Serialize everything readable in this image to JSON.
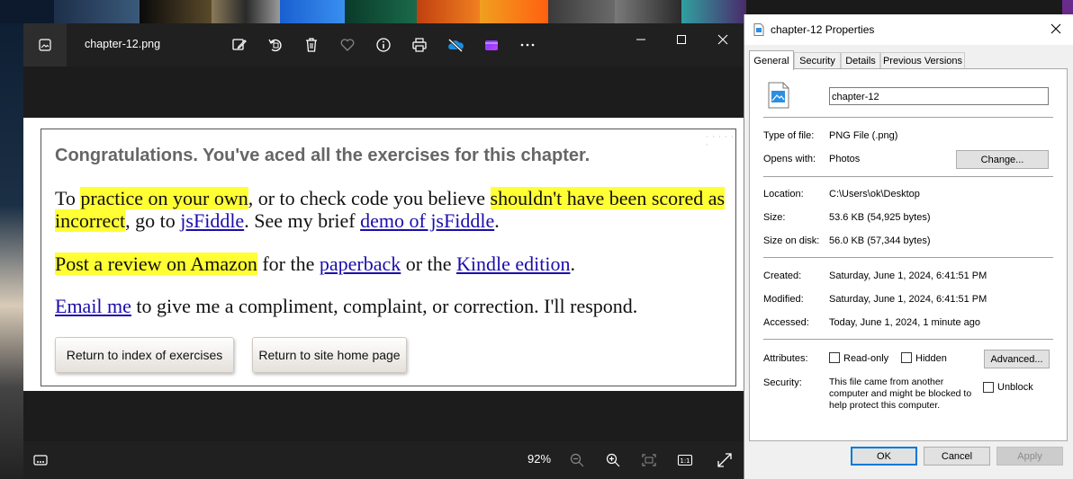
{
  "photos": {
    "filename": "chapter-12.png",
    "zoom": "92%",
    "toolbar_icons": [
      "edit-icon",
      "rotate-icon",
      "delete-icon",
      "favorite-icon",
      "info-icon",
      "print-icon",
      "onedrive-icon",
      "clipchamp-icon",
      "more-icon"
    ],
    "image": {
      "heading": "Congratulations. You've aced all the exercises for this chapter.",
      "p1": {
        "t1": "To ",
        "h1": "practice on your own",
        "t2": ", or to check code you believe ",
        "h2": "shouldn't have been scored as incorrect",
        "t3": ", go to ",
        "l1": "jsFiddle",
        "t4": ". See my brief ",
        "l2": "demo of jsFiddle",
        "t5": "."
      },
      "p2": {
        "h1": "Post a review on Amazon",
        "t1": " for the ",
        "l1": "paperback",
        "t2": " or the ",
        "l2": "Kindle edition",
        "t3": "."
      },
      "p3": {
        "l1": "Email me",
        "t1": " to give me a compliment, complaint, or correction. I'll respond."
      },
      "btn_index": "Return to index of exercises",
      "btn_home": "Return to site home page",
      "highlight_color": "#ffff33",
      "link_color": "#1a0dab"
    }
  },
  "properties": {
    "title": "chapter-12 Properties",
    "tabs": [
      "General",
      "Security",
      "Details",
      "Previous Versions"
    ],
    "name": "chapter-12",
    "type_label": "Type of file:",
    "type_value": "PNG File (.png)",
    "opens_label": "Opens with:",
    "opens_value": "Photos",
    "change": "Change...",
    "location_label": "Location:",
    "location_value": "C:\\Users\\ok\\Desktop",
    "size_label": "Size:",
    "size_value": "53.6 KB (54,925 bytes)",
    "disk_label": "Size on disk:",
    "disk_value": "56.0 KB (57,344 bytes)",
    "created_label": "Created:",
    "created_value": "Saturday, June 1, 2024, 6:41:51 PM",
    "modified_label": "Modified:",
    "modified_value": "Saturday, June 1, 2024, 6:41:51 PM",
    "accessed_label": "Accessed:",
    "accessed_value": "Today, June 1, 2024, 1 minute ago",
    "attributes_label": "Attributes:",
    "readonly": "Read-only",
    "hidden": "Hidden",
    "advanced": "Advanced...",
    "security_label": "Security:",
    "security_text": "This file came from another computer and might be blocked to help protect this computer.",
    "unblock": "Unblock",
    "ok": "OK",
    "cancel": "Cancel",
    "apply": "Apply",
    "accent_color": "#0078d7"
  }
}
